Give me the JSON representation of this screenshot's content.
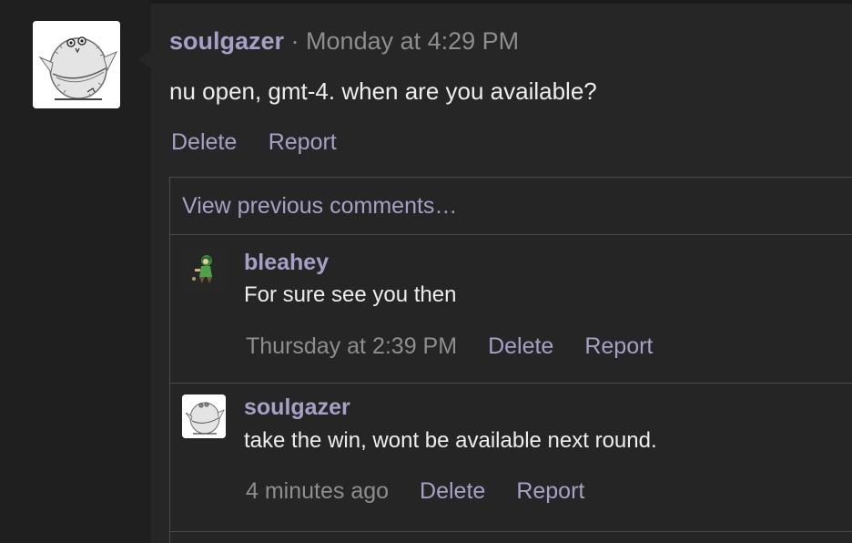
{
  "post": {
    "author": "soulgazer",
    "separator": " · ",
    "timestamp": "Monday at 4:29 PM",
    "body": "nu open, gmt-4. when are you available?",
    "actions": {
      "delete": "Delete",
      "report": "Report"
    }
  },
  "comments": {
    "view_previous": "View previous comments…",
    "items": [
      {
        "author": "bleahey",
        "text": "For sure see you then",
        "timestamp": "Thursday at 2:39 PM",
        "delete": "Delete",
        "report": "Report"
      },
      {
        "author": "soulgazer",
        "text": "take the win, wont be available next round.",
        "timestamp": "4 minutes ago",
        "delete": "Delete",
        "report": "Report"
      }
    ]
  }
}
